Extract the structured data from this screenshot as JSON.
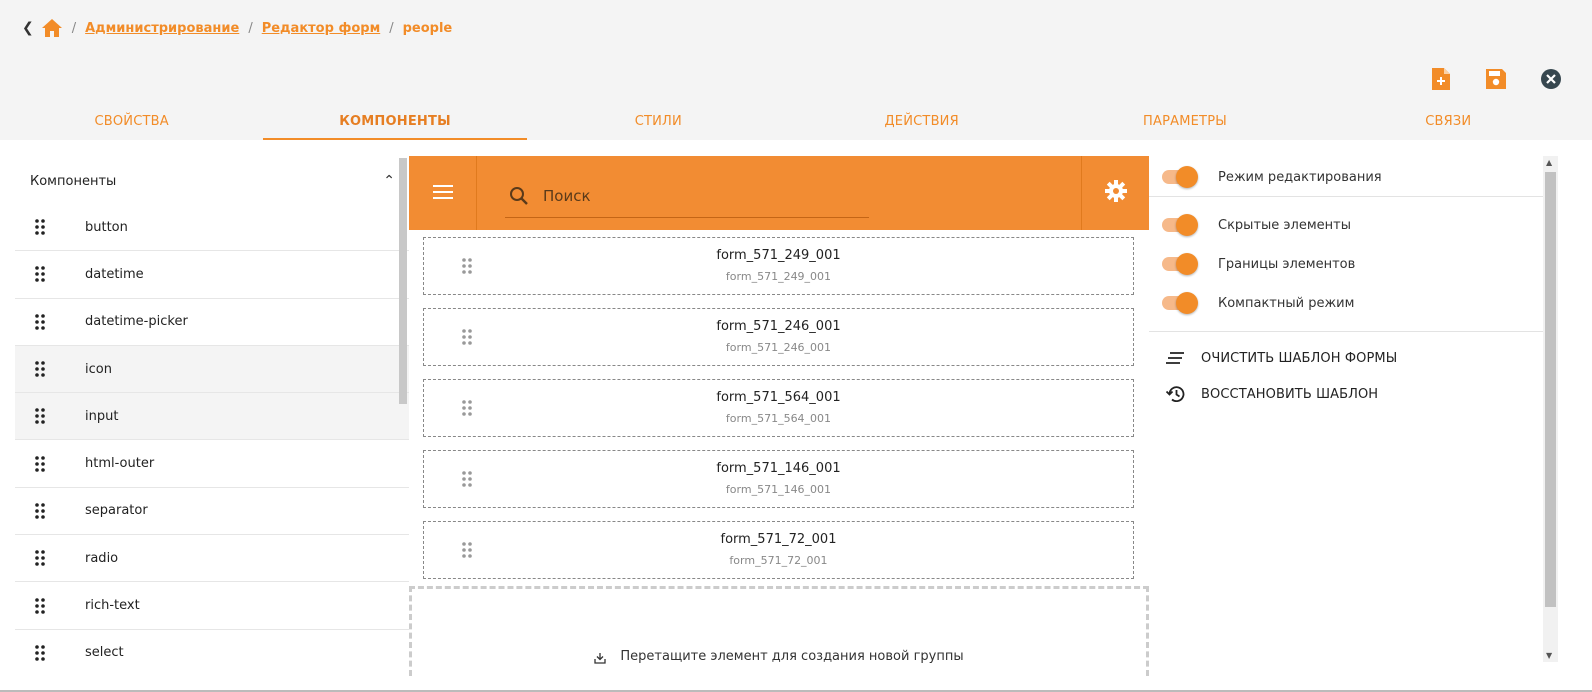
{
  "breadcrumb": {
    "back_icon": "chevron-left-icon",
    "home_icon": "home-icon",
    "items": [
      "Администрирование",
      "Редактор форм"
    ],
    "current": "people",
    "separator": "/"
  },
  "top_actions": [
    "new-file-icon",
    "save-icon",
    "close-circle-icon"
  ],
  "tabs": [
    {
      "label": "СВОЙСТВА",
      "active": false
    },
    {
      "label": "КОМПОНЕНТЫ",
      "active": true
    },
    {
      "label": "СТИЛИ",
      "active": false
    },
    {
      "label": "ДЕЙСТВИЯ",
      "active": false
    },
    {
      "label": "ПАРАМЕТРЫ",
      "active": false
    },
    {
      "label": "СВЯЗИ",
      "active": false
    }
  ],
  "components": {
    "title": "Компоненты",
    "items": [
      "button",
      "datetime",
      "datetime-picker",
      "icon",
      "input",
      "html-outer",
      "separator",
      "radio",
      "rich-text",
      "select"
    ]
  },
  "center": {
    "search_placeholder": "Поиск",
    "forms": [
      {
        "title": "form_571_249_001",
        "subtitle": "form_571_249_001"
      },
      {
        "title": "form_571_246_001",
        "subtitle": "form_571_246_001"
      },
      {
        "title": "form_571_564_001",
        "subtitle": "form_571_564_001"
      },
      {
        "title": "form_571_146_001",
        "subtitle": "form_571_146_001"
      },
      {
        "title": "form_571_72_001",
        "subtitle": "form_571_72_001"
      }
    ],
    "dropzone_text": "Перетащите элемент для создания новой группы"
  },
  "right": {
    "toggles": [
      {
        "label": "Режим редактирования",
        "on": true
      },
      {
        "label": "Скрытые элементы",
        "on": true
      },
      {
        "label": "Границы элементов",
        "on": true
      },
      {
        "label": "Компактный режим",
        "on": true
      }
    ],
    "actions": [
      {
        "label": "ОЧИСТИТЬ ШАБЛОН ФОРМЫ",
        "icon": "clear-all-icon"
      },
      {
        "label": "ВОССТАНОВИТЬ ШАБЛОН",
        "icon": "restore-history-icon"
      }
    ]
  },
  "colors": {
    "accent": "#f28c28",
    "toolbar": "#f28c33",
    "toggle_track": "#f6b98a"
  }
}
